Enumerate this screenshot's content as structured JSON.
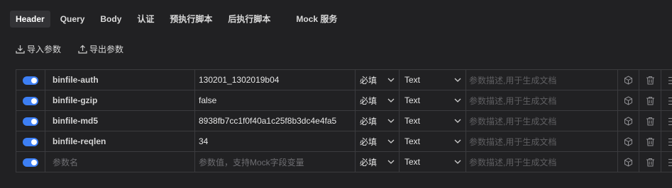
{
  "tabs": [
    {
      "label": "Header",
      "active": true
    },
    {
      "label": "Query"
    },
    {
      "label": "Body"
    },
    {
      "label": "认证"
    },
    {
      "label": "预执行脚本"
    },
    {
      "label": "后执行脚本"
    },
    {
      "label": "Mock 服务"
    }
  ],
  "actions": {
    "import_label": "导入参数",
    "export_label": "导出参数"
  },
  "rows": [
    {
      "enabled": true,
      "key": "binfile-auth",
      "value": "130201_1302019b04",
      "required": "必填",
      "type": "Text",
      "desc_placeholder": "参数描述,用于生成文档"
    },
    {
      "enabled": true,
      "key": "binfile-gzip",
      "value": "false",
      "required": "必填",
      "type": "Text",
      "desc_placeholder": "参数描述,用于生成文档"
    },
    {
      "enabled": true,
      "key": "binfile-md5",
      "value": "8938fb7cc1f0f40a1c25f8b3dc4e4fa5",
      "required": "必填",
      "type": "Text",
      "desc_placeholder": "参数描述,用于生成文档"
    },
    {
      "enabled": true,
      "key": "binfile-reqlen",
      "value": "34",
      "required": "必填",
      "type": "Text",
      "desc_placeholder": "参数描述,用于生成文档"
    }
  ],
  "new_row": {
    "enabled": true,
    "key_placeholder": "参数名",
    "value_placeholder": "参数值，支持Mock字段变量",
    "required": "必填",
    "type": "Text",
    "desc_placeholder": "参数描述,用于生成文档"
  },
  "colors": {
    "accent": "#3d7ff4",
    "background": "#212123",
    "border": "#3b3b3e"
  },
  "icons": [
    "download-icon",
    "upload-icon",
    "cube-icon",
    "trash-icon",
    "menu-icon",
    "chevron-down-icon"
  ]
}
